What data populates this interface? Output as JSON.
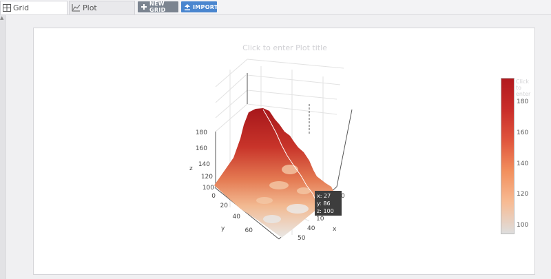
{
  "tabs": [
    {
      "label": "Grid",
      "icon": "grid-icon"
    },
    {
      "label": "Plot",
      "icon": "line-chart-icon"
    }
  ],
  "toolbar": {
    "new_grid_label": "NEW GRID",
    "import_label": "IMPORT",
    "new_grid_icon": "plus-icon",
    "import_icon": "upload-icon"
  },
  "plot": {
    "title_placeholder": "Click to enter Plot title",
    "axis_labels": {
      "x": "x",
      "y": "y",
      "z": "z"
    },
    "x_ticks": [
      "0",
      "10",
      "40",
      "50"
    ],
    "y_ticks": [
      "0",
      "20",
      "40",
      "60"
    ],
    "z_ticks": [
      "100",
      "120",
      "140",
      "160",
      "180"
    ],
    "hover": {
      "x": "x: 27",
      "y": "y: 86",
      "z": "z: 100"
    },
    "colorbar": {
      "title": "Click to enter",
      "ticks": [
        "180",
        "160",
        "140",
        "120",
        "100"
      ],
      "colorscale": [
        "#dedede",
        "#f7bb94",
        "#f2905e",
        "#e0553d",
        "#c92d2a",
        "#b2191e"
      ]
    }
  },
  "chart_data": {
    "type": "surface",
    "title": "",
    "zlim": [
      100,
      190
    ],
    "colorbar_range": [
      95,
      195
    ]
  }
}
